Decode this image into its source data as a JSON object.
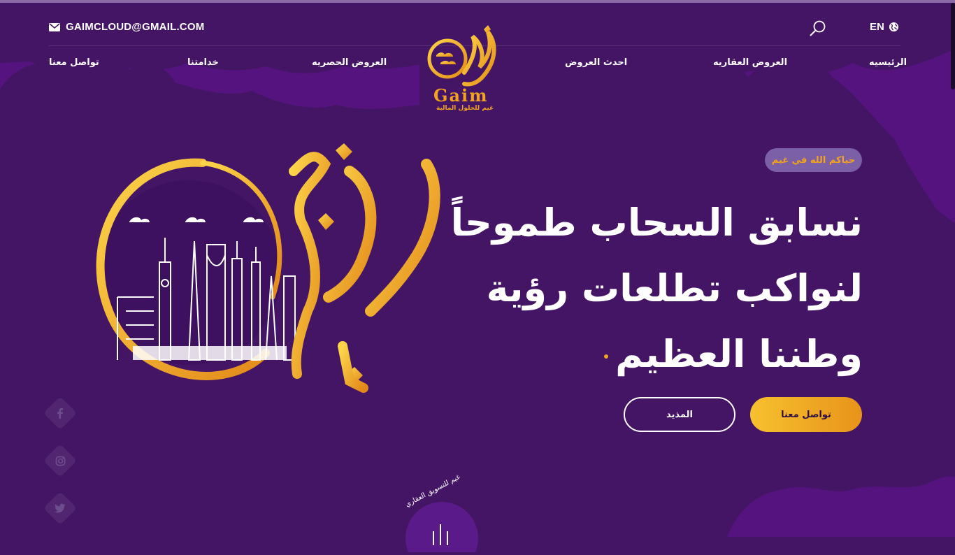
{
  "header": {
    "email": "GAIMCLOUD@GMAIL.COM",
    "language": "EN"
  },
  "nav": {
    "items": [
      "الرئيسيه",
      "العروض العقاريه",
      "احدث العروض",
      "العروض الحصريه",
      "خدامتنا",
      "تواصل معنا"
    ]
  },
  "logo": {
    "brand_latin": "Gaim",
    "tagline": "غيم للحلول المالية"
  },
  "hero": {
    "welcome": "حياكم الله في غيم",
    "headline_line1": "نسابق السحاب طموحاً",
    "headline_line2": "لنواكب تطلعات رؤية",
    "headline_line3": "وطننا العظيم",
    "contact_button": "تواصل معنا",
    "more_button": "المذيد"
  },
  "social": {
    "icons": [
      "facebook-icon",
      "instagram-icon",
      "twitter-icon"
    ]
  },
  "badge": {
    "circular_text": "غيم للتسويق العقاري"
  },
  "colors": {
    "background": "#431564",
    "accent_gold": "#f1a21e",
    "welcome_pill": "#7b5fa7",
    "cloud_purple": "#55137f"
  }
}
